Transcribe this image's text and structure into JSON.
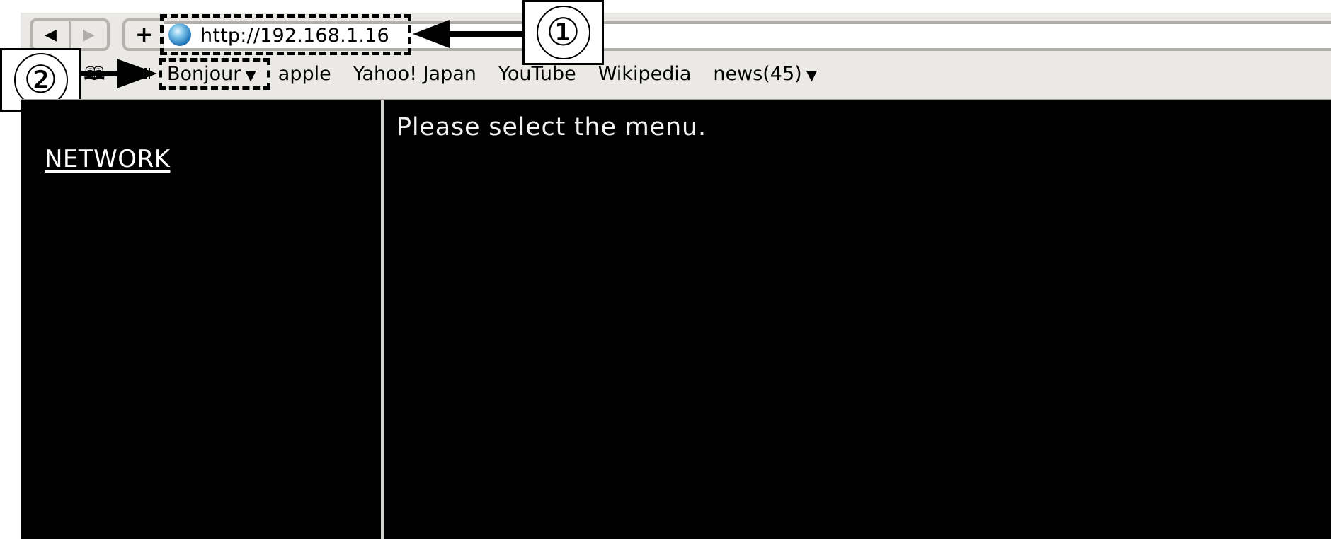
{
  "browser": {
    "nav": {
      "back_icon": "◀",
      "forward_icon": "▶",
      "new_tab_icon": "+"
    },
    "address_bar": {
      "url": "http://192.168.1.16",
      "site_icon": "globe-icon"
    },
    "bookmarks_icon": "book-icon",
    "bookmarks": [
      {
        "label": "Bonjour",
        "has_menu": true
      },
      {
        "label": "apple",
        "has_menu": false
      },
      {
        "label": "Yahoo! Japan",
        "has_menu": false
      },
      {
        "label": "YouTube",
        "has_menu": false
      },
      {
        "label": "Wikipedia",
        "has_menu": false
      },
      {
        "label": "news(45)",
        "has_menu": true
      }
    ],
    "menu_caret": "▼"
  },
  "page": {
    "sidebar": {
      "items": [
        {
          "label": "NETWORK"
        }
      ]
    },
    "main": {
      "message": "Please select the menu."
    }
  },
  "annotations": {
    "callout_1": "①",
    "callout_2": "②"
  },
  "colors": {
    "chrome_bg": "#eae9e5",
    "border_gray": "#b2b0ab",
    "page_bg": "#000000",
    "page_text": "#ffffff"
  }
}
